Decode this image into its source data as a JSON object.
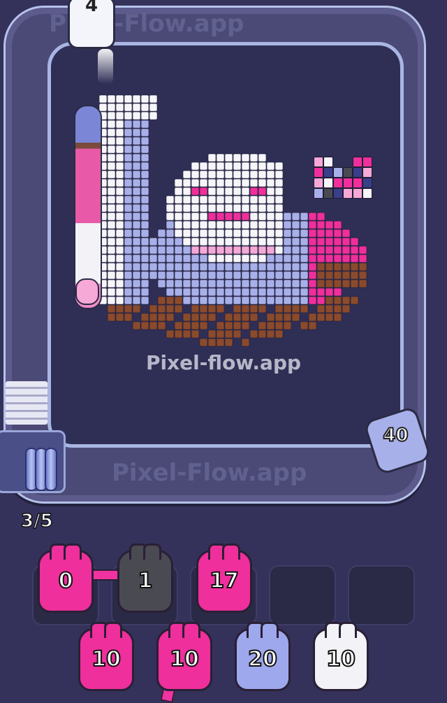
{
  "game": {
    "watermark_track_top": "Pixel-Flow.app",
    "watermark_center": "Pixel-flow.app",
    "watermark_track_bottom": "Pixel-Flow.app",
    "progress": "3/5"
  },
  "shooters_on_belt": [
    {
      "id": "top",
      "value": "4",
      "color": "#f4f4fb"
    },
    {
      "id": "right",
      "value": "40",
      "color": "#a8b0ea"
    }
  ],
  "active_slots": [
    {
      "value": "0",
      "color": "#ef2f9b"
    },
    {
      "value": "1",
      "color": "#4a4a52"
    },
    {
      "value": "17",
      "color": "#ef2f9b"
    }
  ],
  "empty_slots": 2,
  "queue": [
    {
      "value": "10",
      "color": "#ef2f9b"
    },
    {
      "value": "10",
      "color": "#ef2f9b"
    },
    {
      "value": "20",
      "color": "#9ea8ec"
    },
    {
      "value": "10",
      "color": "#f2f2f7"
    }
  ],
  "palette_colors": {
    "white": "#f6f6fa",
    "lavender": "#a8b0ea",
    "pink": "#ef2f9b",
    "lightpink": "#f6a8d6",
    "brown": "#8a4a2c",
    "gray": "#4a4a52",
    "navy": "#3b3f8a"
  }
}
